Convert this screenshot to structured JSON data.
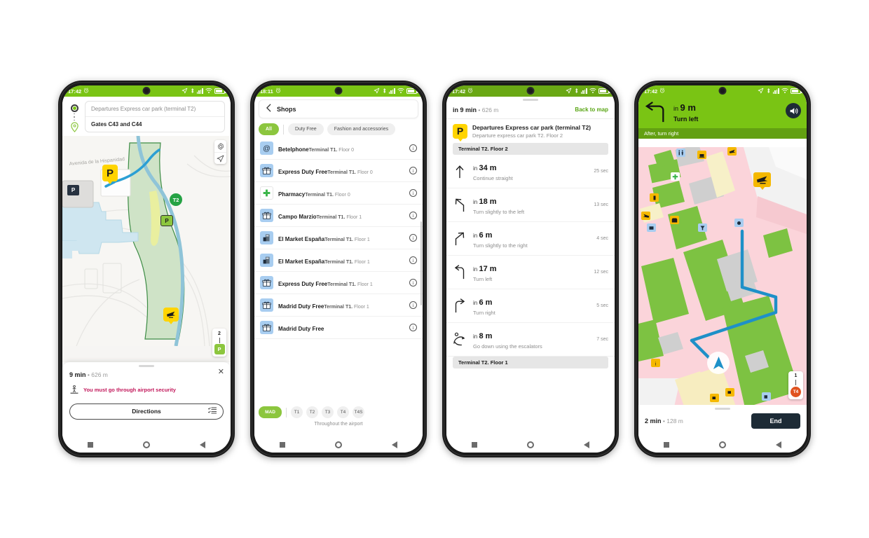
{
  "meta": {
    "accent_green": "#7ac414",
    "chip_green": "#8cc63e",
    "warn_pink": "#c2185b",
    "dark_navy": "#1d2b36",
    "marker_yellow": "#ffd400"
  },
  "phone1": {
    "status": {
      "time": "17:42"
    },
    "route": {
      "origin": "Departures Express car park (terminal T2)",
      "destination": "Gates C43 and C44"
    },
    "map": {
      "street_label": "Avenida de la Hispanidad",
      "markers": {
        "parking_big": "P",
        "terminal": "T2",
        "parking_green": "P",
        "parking_dark": "P"
      },
      "floor_top": "2",
      "floor_current": "P"
    },
    "sheet": {
      "duration": "9 min",
      "separator": "•",
      "distance": "626 m",
      "warning": "You must go through airport security",
      "directions_label": "Directions"
    }
  },
  "phone2": {
    "status": {
      "time": "18:11"
    },
    "header": {
      "title": "Shops"
    },
    "filters": [
      {
        "label": "All",
        "active": true
      },
      {
        "label": "Duty Free",
        "active": false
      },
      {
        "label": "Fashion and accessories",
        "active": false
      }
    ],
    "shops": [
      {
        "name": "Betelphone",
        "location_terminal": "Terminal T1.",
        "location_floor": "Floor 0",
        "icon": "at-sign-icon"
      },
      {
        "name": "Express Duty Free",
        "location_terminal": "Terminal T1.",
        "location_floor": "Floor 0",
        "icon": "gift-icon"
      },
      {
        "name": "Pharmacy",
        "location_terminal": "Terminal T1.",
        "location_floor": "Floor 0",
        "icon": "pharmacy-cross-icon"
      },
      {
        "name": "Campo Marzio",
        "location_terminal": "Terminal T1.",
        "location_floor": "Floor 1",
        "icon": "gift-icon"
      },
      {
        "name": "El Market España",
        "location_terminal": "Terminal T1.",
        "location_floor": "Floor 1",
        "icon": "shop-icon"
      },
      {
        "name": "El Market España",
        "location_terminal": "Terminal T1.",
        "location_floor": "Floor 1",
        "icon": "shop-icon"
      },
      {
        "name": "Express Duty Free",
        "location_terminal": "Terminal T1.",
        "location_floor": "Floor 1",
        "icon": "gift-icon"
      },
      {
        "name": "Madrid Duty Free",
        "location_terminal": "Terminal T1.",
        "location_floor": "Floor 1",
        "icon": "gift-icon"
      },
      {
        "name": "Madrid Duty Free",
        "location_terminal": "",
        "location_floor": "",
        "icon": "gift-icon"
      }
    ],
    "terminals": [
      {
        "label": "MAD",
        "active": true
      },
      {
        "label": "T1",
        "active": false
      },
      {
        "label": "T2",
        "active": false
      },
      {
        "label": "T3",
        "active": false
      },
      {
        "label": "T4",
        "active": false
      },
      {
        "label": "T4S",
        "active": false
      }
    ],
    "terminal_note": "Throughout the airport"
  },
  "phone3": {
    "status": {
      "time": "17:42"
    },
    "header": {
      "eta_prefix": "in 9 min",
      "separator": "•",
      "distance": "626 m",
      "back_label": "Back to map"
    },
    "origin": {
      "marker": "P",
      "name": "Departures Express car park (terminal T2)",
      "sub": "Departure express car park T2. Floor 2"
    },
    "floor_band_top": "Terminal T2. Floor 2",
    "floor_band_bottom": "Terminal T2. Floor 1",
    "steps": [
      {
        "distance_prefix": "in",
        "distance": "34 m",
        "instruction": "Continue straight",
        "time": "25 sec",
        "icon": "arrow-straight-icon"
      },
      {
        "distance_prefix": "in",
        "distance": "18 m",
        "instruction": "Turn slightly to the left",
        "time": "13 sec",
        "icon": "arrow-slight-left-icon"
      },
      {
        "distance_prefix": "in",
        "distance": "6 m",
        "instruction": "Turn slightly to the right",
        "time": "4 sec",
        "icon": "arrow-slight-right-icon"
      },
      {
        "distance_prefix": "in",
        "distance": "17 m",
        "instruction": "Turn left",
        "time": "12 sec",
        "icon": "arrow-left-icon"
      },
      {
        "distance_prefix": "in",
        "distance": "6 m",
        "instruction": "Turn right",
        "time": "5 sec",
        "icon": "arrow-right-icon"
      },
      {
        "distance_prefix": "in",
        "distance": "8 m",
        "instruction": "Go down using the escalators",
        "time": "7 sec",
        "icon": "escalator-down-icon"
      }
    ]
  },
  "phone4": {
    "status": {
      "time": "17:42"
    },
    "nav": {
      "distance_prefix": "in",
      "distance": "9 m",
      "instruction": "Turn left",
      "after": "After, turn right"
    },
    "map": {
      "floor_top": "1",
      "floor_current": "T4"
    },
    "sheet": {
      "duration": "2 min",
      "separator": "•",
      "distance": "128 m",
      "end_label": "End"
    }
  }
}
